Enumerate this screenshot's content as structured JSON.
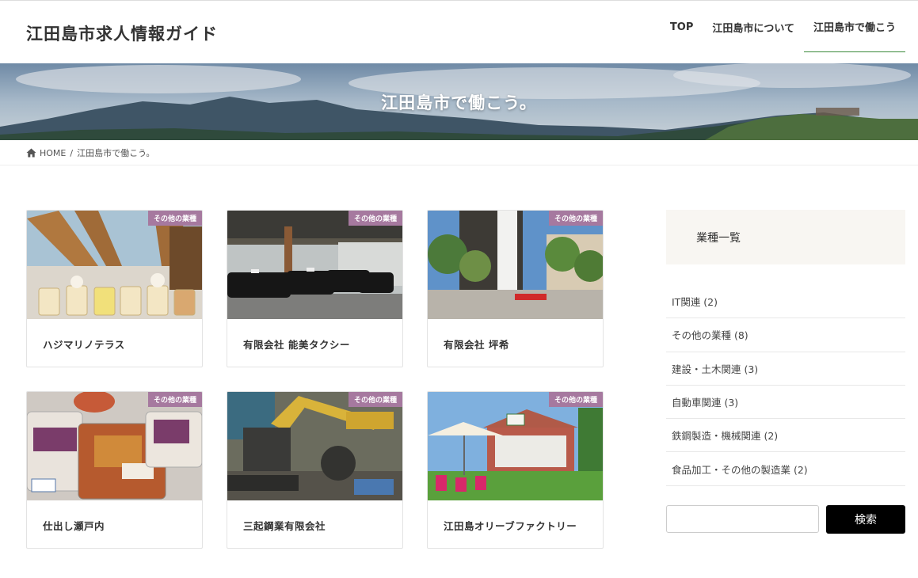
{
  "header": {
    "site_title": "江田島市求人情報ガイド",
    "nav": [
      {
        "label": "TOP"
      },
      {
        "label": "江田島市について"
      },
      {
        "label": "江田島市で働こう"
      }
    ]
  },
  "hero": {
    "title": "江田島市で働こう。"
  },
  "breadcrumb": {
    "home": "HOME",
    "separator": "/",
    "current": "江田島市で働こう。"
  },
  "cards": [
    {
      "tag": "その他の業種",
      "title": "ハジマリノテラス",
      "image_icon": "drinks-photo"
    },
    {
      "tag": "その他の業種",
      "title": "有限会社 能美タクシー",
      "image_icon": "taxi-garage-photo"
    },
    {
      "tag": "その他の業種",
      "title": "有限会社 坪希",
      "image_icon": "garden-house-photo"
    },
    {
      "tag": "その他の業種",
      "title": "仕出し瀬戸内",
      "image_icon": "bento-photo"
    },
    {
      "tag": "その他の業種",
      "title": "三起鋼業有限会社",
      "image_icon": "excavator-photo"
    },
    {
      "tag": "その他の業種",
      "title": "江田島オリーブファクトリー",
      "image_icon": "olive-factory-photo"
    }
  ],
  "sidebar": {
    "title": "業種一覧",
    "categories": [
      {
        "label": "IT関連 (2)"
      },
      {
        "label": "その他の業種 (8)"
      },
      {
        "label": "建設・土木関連 (3)"
      },
      {
        "label": "自動車関連 (3)"
      },
      {
        "label": "鉄鋼製造・機械関連 (2)"
      },
      {
        "label": "食品加工・その他の製造業 (2)"
      }
    ],
    "search_placeholder": "",
    "search_button": "検索"
  },
  "colors": {
    "tag_bg": "#a6799f",
    "active_nav_underline": "#3a8a3a",
    "sidebar_head_bg": "#f8f6f2"
  }
}
